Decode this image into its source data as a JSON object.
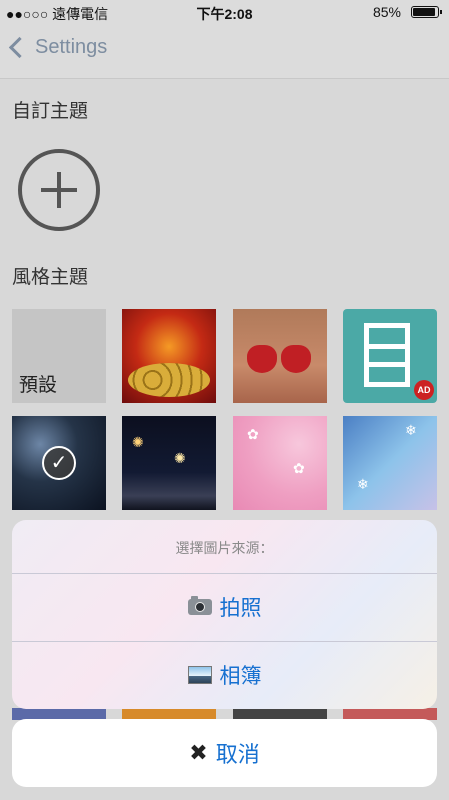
{
  "status_bar": {
    "carrier": "●●○○○ 遠傳電信",
    "time": "下午2:08",
    "battery_percent": "85%",
    "battery_level": 0.85
  },
  "nav": {
    "back_label": "Settings"
  },
  "sections": {
    "custom_theme": "自訂主題",
    "style_theme": "風格主題"
  },
  "themes": {
    "default_label": "預設",
    "ad_badge": "AD"
  },
  "action_sheet": {
    "title": "選擇圖片來源：",
    "items": [
      {
        "label": "拍照",
        "icon": "camera-icon"
      },
      {
        "label": "相簿",
        "icon": "photo-album-icon"
      }
    ],
    "cancel_label": "取消",
    "cancel_icon": "close-icon"
  }
}
